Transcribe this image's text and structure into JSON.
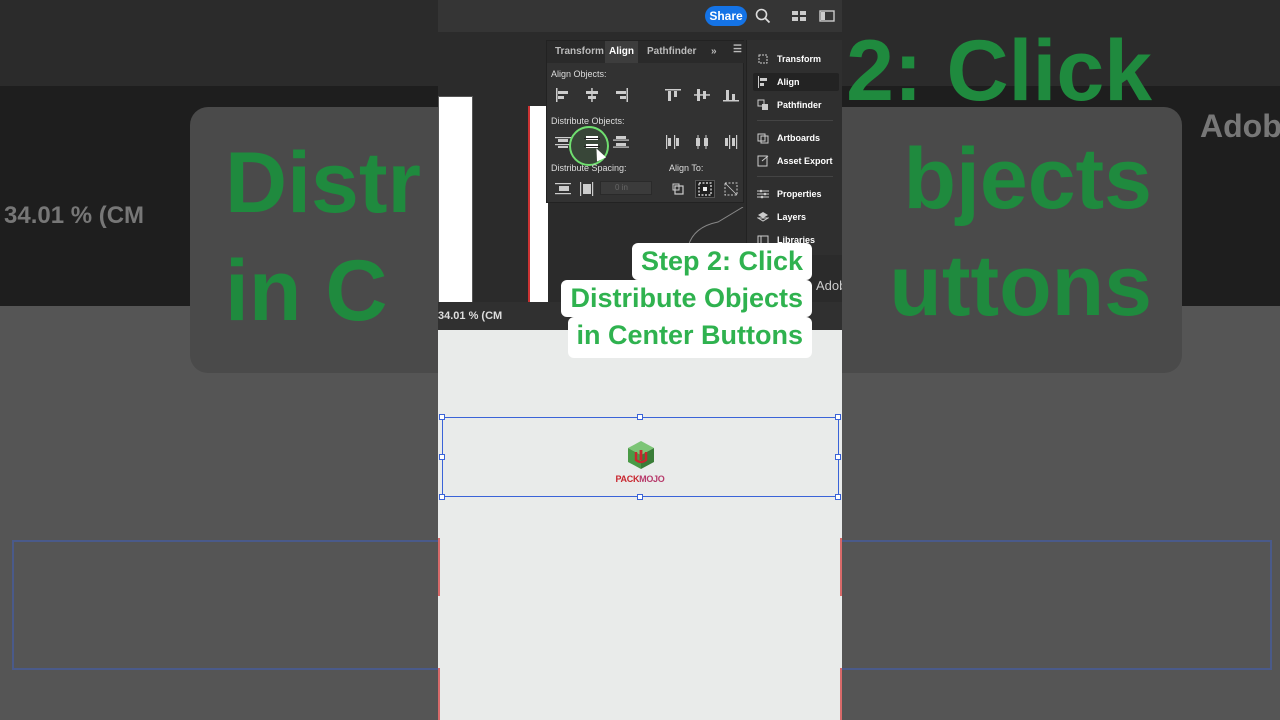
{
  "topbar": {
    "share_label": "Share",
    "icons": [
      "search-icon",
      "workspace-icon",
      "panel-toggle-icon"
    ]
  },
  "document": {
    "zoom_label": "34.01 % (CM",
    "right_edge_label": "Adob"
  },
  "align_panel": {
    "tabs": [
      {
        "label": "Transform",
        "active": false
      },
      {
        "label": "Align",
        "active": true
      },
      {
        "label": "Pathfinder",
        "active": false
      }
    ],
    "align_objects_label": "Align Objects:",
    "distribute_objects_label": "Distribute Objects:",
    "distribute_spacing_label": "Distribute Spacing:",
    "align_to_label": "Align To:",
    "spacing_value": "0 in"
  },
  "dock": {
    "items": [
      {
        "label": "Transform",
        "icon": "transform-icon",
        "active": false
      },
      {
        "label": "Align",
        "icon": "align-icon",
        "active": true
      },
      {
        "label": "Pathfinder",
        "icon": "pathfinder-icon",
        "active": false
      },
      {
        "label": "Artboards",
        "icon": "artboards-icon",
        "active": false
      },
      {
        "label": "Asset Export",
        "icon": "asset-export-icon",
        "active": false
      },
      {
        "label": "Properties",
        "icon": "properties-icon",
        "active": false
      },
      {
        "label": "Layers",
        "icon": "layers-icon",
        "active": false
      },
      {
        "label": "Libraries",
        "icon": "libraries-icon",
        "active": false
      }
    ]
  },
  "callout": {
    "line1": "Step 2: Click",
    "line2": "Distribute Objects",
    "line3": "in Center Buttons",
    "color": "#2fb24f"
  },
  "canvas": {
    "logo_text_a": "PACK",
    "logo_text_b": "MOJO",
    "brand_color": "#c9262e"
  },
  "background": {
    "overlay_text_left": "Distr\nin C",
    "overlay_text_right": "2: Click\nbjects\nuttons",
    "zoom_echo": "34.01 % (CM",
    "adob_echo": "Adob"
  }
}
